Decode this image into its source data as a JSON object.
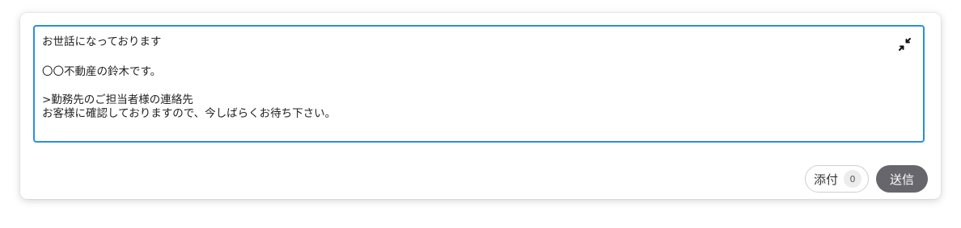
{
  "message": {
    "line1": "お世話になっております",
    "line2": "〇〇不動産の鈴木です。",
    "line3": ">勤務先のご担当者様の連絡先",
    "line4": "お客様に確認しておりますので、今しばらくお待ち下さい。"
  },
  "editor": {
    "collapse_icon": "collapse-arrows-icon",
    "border_color": "#2a8fe0"
  },
  "footer": {
    "attach_label": "添付",
    "attach_count": "0",
    "send_label": "送信",
    "send_color": "#66666c"
  }
}
